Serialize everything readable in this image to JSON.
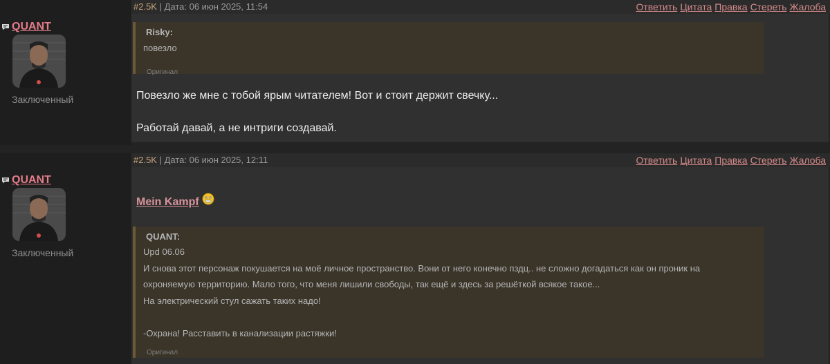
{
  "posts": [
    {
      "author": "QUANT",
      "rank": "Заключенный",
      "post_id": "#2.5K",
      "date": "| Дата: 06 июн 2025, 11:54",
      "actions": [
        "Ответить",
        "Цитата",
        "Правка",
        "Стереть",
        "Жалоба"
      ],
      "quote": {
        "author": "Risky:",
        "lines": [
          "повезло"
        ],
        "original_label": "Оригинал"
      },
      "text_lines": [
        "Повезло же мне с тобой ярым читателем! Вот и стоит держит свечку...",
        "Работай давай, а не интриги создавай."
      ]
    },
    {
      "author": "QUANT",
      "rank": "Заключенный",
      "post_id": "#2.5K",
      "date": "| Дата: 06 июн 2025, 12:11",
      "actions": [
        "Ответить",
        "Цитата",
        "Правка",
        "Стереть",
        "Жалоба"
      ],
      "link_title": "Mein Kampf",
      "emoji": "scared-face-icon",
      "quote": {
        "author": "QUANT:",
        "lines": [
          "Upd 06.06",
          "И снова этот персонаж покушается на моё личное пространство. Вони от него конечно пздц.. не сложно догадаться как он проник на",
          "охроняемую территорию. Мало того, что меня лишили свободы, так ещё и здесь за решёткой всякое такое...",
          "На электрический стул сажать таких надо!",
          "",
          "-Охрана! Расставить в канализации растяжки!"
        ],
        "original_label": "Оригинал"
      }
    }
  ],
  "colors": {
    "background": "#232323",
    "sidebar": "#1e1e1e",
    "header": "#2b2b2b",
    "body": "#303030",
    "quote": "#3a3429",
    "quote_border": "#6b5a36",
    "author": "#e27d8a",
    "action_link": "#d58a8a",
    "post_id": "#c5a37a"
  }
}
